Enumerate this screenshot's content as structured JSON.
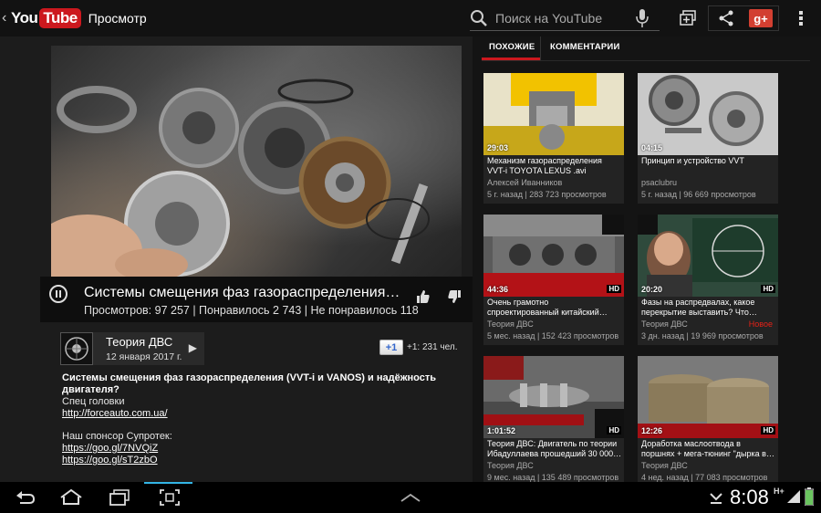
{
  "actionbar": {
    "logo_you": "You",
    "logo_tube": "Tube",
    "title": "Просмотр",
    "search_placeholder": "Поиск на YouTube"
  },
  "video": {
    "title": "Системы смещения фаз газораспределения…",
    "stats": "Просмотров: 97 257 | Понравилось 2 743 | Не понравилось 118"
  },
  "channel": {
    "name": "Теория ДВС",
    "date": "12 января 2017 г."
  },
  "plusone": {
    "label": "+1",
    "count": "+1: 231 чел."
  },
  "description": {
    "title": "Системы смещения фаз газораспределения (VVT-i и VANOS) и надёжность двигателя?",
    "line1": "Спец головки",
    "link1": "http://forceauto.com.ua/",
    "line2": "Наш спонсор Супротек:",
    "link2": "https://goo.gl/7NVQiZ",
    "link3": "https://goo.gl/sT2zbO"
  },
  "tabs": {
    "related": "ПОХОЖИЕ",
    "comments": "КОММЕНТАРИИ"
  },
  "related": [
    {
      "duration": "29:03",
      "title_l1": "Механизм газораспределения",
      "title_l2": "VVT-i TOYOTA LEXUS .avi",
      "channel": "Алексей Иванников",
      "meta": "5 г. назад | 283 723 просмотров",
      "hd": "",
      "new": ""
    },
    {
      "duration": "04:15",
      "title_l1": "Принцип и устройство VVT",
      "title_l2": "",
      "channel": "psaclubru",
      "meta": "5 г. назад | 96 669 просмотров",
      "hd": "",
      "new": ""
    },
    {
      "duration": "44:36",
      "title_l1": "Очень грамотно",
      "title_l2": "спроектированный китайский…",
      "channel": "Теория ДВС",
      "meta": "5 мес. назад | 152 423 просмотров",
      "hd": "HD",
      "new": ""
    },
    {
      "duration": "20:20",
      "title_l1": "Фазы на распредвалах, какое",
      "title_l2": "перекрытие выставить? Что…",
      "channel": "Теория ДВС",
      "meta": "3 дн. назад | 19 969 просмотров",
      "hd": "HD",
      "new": "Новое"
    },
    {
      "duration": "1:01:52",
      "title_l1": "Теория ДВС: Двигатель по теории",
      "title_l2": "Ибадуллаева прошедший 30 000…",
      "channel": "Теория ДВС",
      "meta": "9 мес. назад | 135 489 просмотров",
      "hd": "HD",
      "new": ""
    },
    {
      "duration": "12:26",
      "title_l1": "Доработка маслоотвода в",
      "title_l2": "поршнях + мега-тюнинг \"дырка в…",
      "channel": "Теория ДВС",
      "meta": "4 нед. назад | 77 083 просмотров",
      "hd": "HD",
      "new": ""
    }
  ],
  "status": {
    "time": "8:08",
    "network": "H+"
  },
  "colors": {
    "accent_red": "#cc181e",
    "nav_blue": "#33b5e5"
  }
}
